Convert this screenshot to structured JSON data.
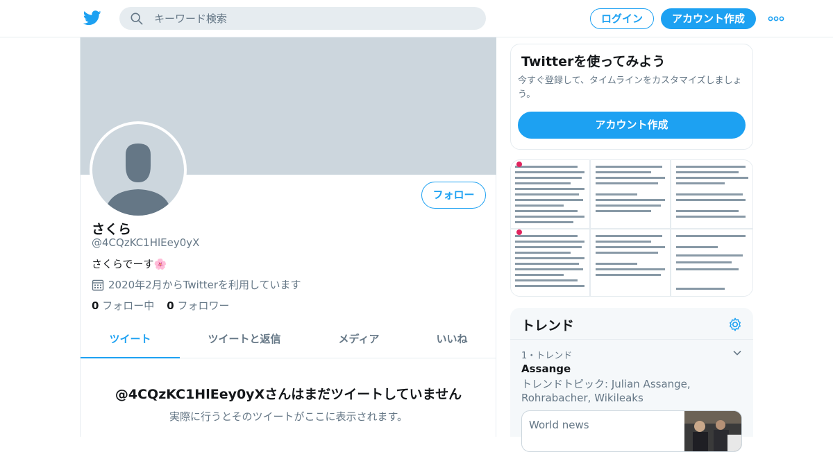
{
  "header": {
    "search_placeholder": "キーワード検索",
    "login_label": "ログイン",
    "signup_label": "アカウント作成"
  },
  "profile": {
    "name": "さくら",
    "handle": "@4CQzKC1HlEey0yX",
    "bio": "さくらでーす🌸",
    "joined": "2020年2月からTwitterを利用しています",
    "following_count": "0",
    "following_label": "フォロー中",
    "followers_count": "0",
    "followers_label": "フォロワー",
    "follow_button": "フォロー"
  },
  "tabs": [
    {
      "label": "ツイート",
      "active": true
    },
    {
      "label": "ツイートと返信",
      "active": false
    },
    {
      "label": "メディア",
      "active": false
    },
    {
      "label": "いいね",
      "active": false
    }
  ],
  "empty_state": {
    "title": "@4CQzKC1HlEey0yXさんはまだツイートしていません",
    "subtitle": "実際に行うとそのツイートがここに表示されます。"
  },
  "promo": {
    "title": "Twitterを使ってみよう",
    "text": "今すぐ登録して、タイムラインをカスタマイズしましょう。",
    "button": "アカウント作成"
  },
  "trends": {
    "title": "トレンド",
    "items": [
      {
        "meta": "1・トレンド",
        "name": "Assange",
        "description": "トレンドトピック: Julian Assange, Rohrabacher, Wikileaks",
        "news_source": "World news"
      }
    ]
  },
  "colors": {
    "accent": "#1da1f2",
    "banner": "#ccd6dd",
    "muted_text": "#657786"
  },
  "icons": [
    "twitter-bird-icon",
    "search-icon",
    "more-icon",
    "calendar-icon",
    "gear-icon",
    "chevron-down-icon"
  ]
}
